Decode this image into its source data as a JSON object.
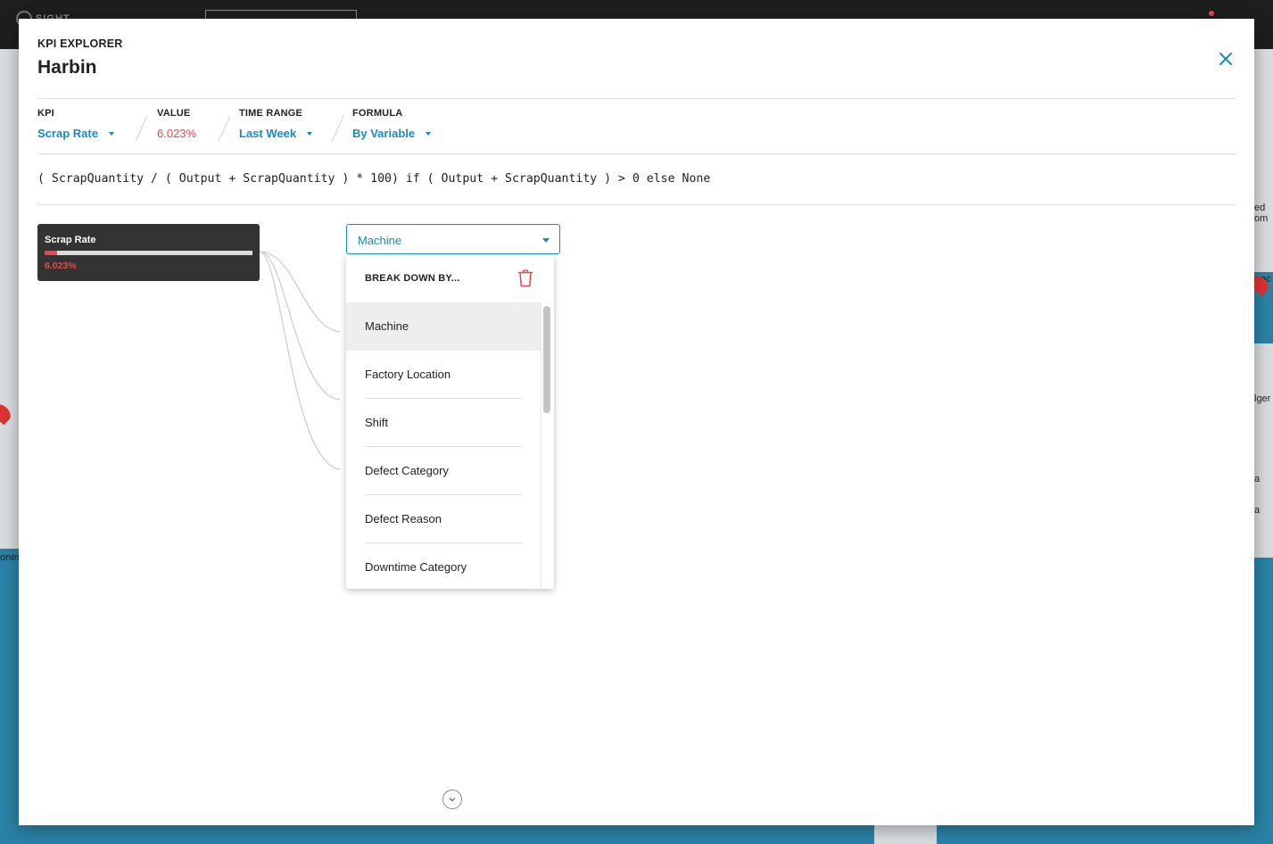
{
  "background": {
    "logo_text": "SIGHT",
    "map_fragments": [
      "ed",
      "om",
      "ac",
      "lger",
      "a",
      "a",
      "ones"
    ]
  },
  "modal": {
    "eyebrow": "KPI EXPLORER",
    "title": "Harbin",
    "close_icon": "close-icon"
  },
  "filters": {
    "kpi": {
      "label": "KPI",
      "value": "Scrap Rate"
    },
    "value": {
      "label": "VALUE",
      "value": "6.023%"
    },
    "time_range": {
      "label": "TIME RANGE",
      "value": "Last Week"
    },
    "formula": {
      "label": "FORMULA",
      "value": "By Variable"
    }
  },
  "formula_text": "( ScrapQuantity / ( Output + ScrapQuantity ) * 100) if ( Output + ScrapQuantity ) > 0 else None",
  "kpi_card": {
    "title": "Scrap Rate",
    "value": "6.023%",
    "progress_fraction": 0.06
  },
  "breakdown": {
    "selected": "Machine",
    "header": "BREAK DOWN BY...",
    "options": [
      "Machine",
      "Factory Location",
      "Shift",
      "Defect Category",
      "Defect Reason",
      "Downtime Category"
    ],
    "active_index": 0
  },
  "colors": {
    "accent": "#1a8ac2",
    "danger": "#e5484d",
    "card_bg": "#333333"
  }
}
